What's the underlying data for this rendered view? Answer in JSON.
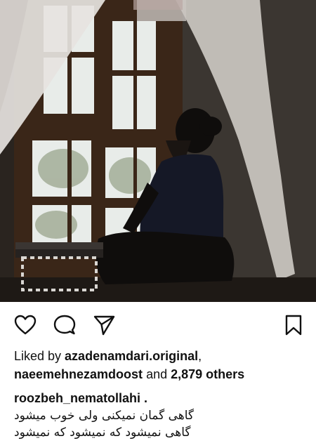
{
  "post": {
    "image_alt": "Man with beard sitting by a window with curtains",
    "actions": {
      "like_icon": "heart-outline",
      "comment_icon": "comment-bubble",
      "share_icon": "paper-plane",
      "save_icon": "bookmark-outline"
    },
    "likes": {
      "prefix": "Liked by ",
      "user1": "azadenamdari.original",
      "sep": ",",
      "user2": "naeemehnezamdoost",
      "middle": " and ",
      "count": "2,879 others"
    },
    "caption": {
      "username": "roozbeh_nematollahi .",
      "line1": "گاهی گمان نمیکنی ولی خوب میشود",
      "line2": "گاهی نمیشود که نمیشود که نمیشود"
    }
  }
}
